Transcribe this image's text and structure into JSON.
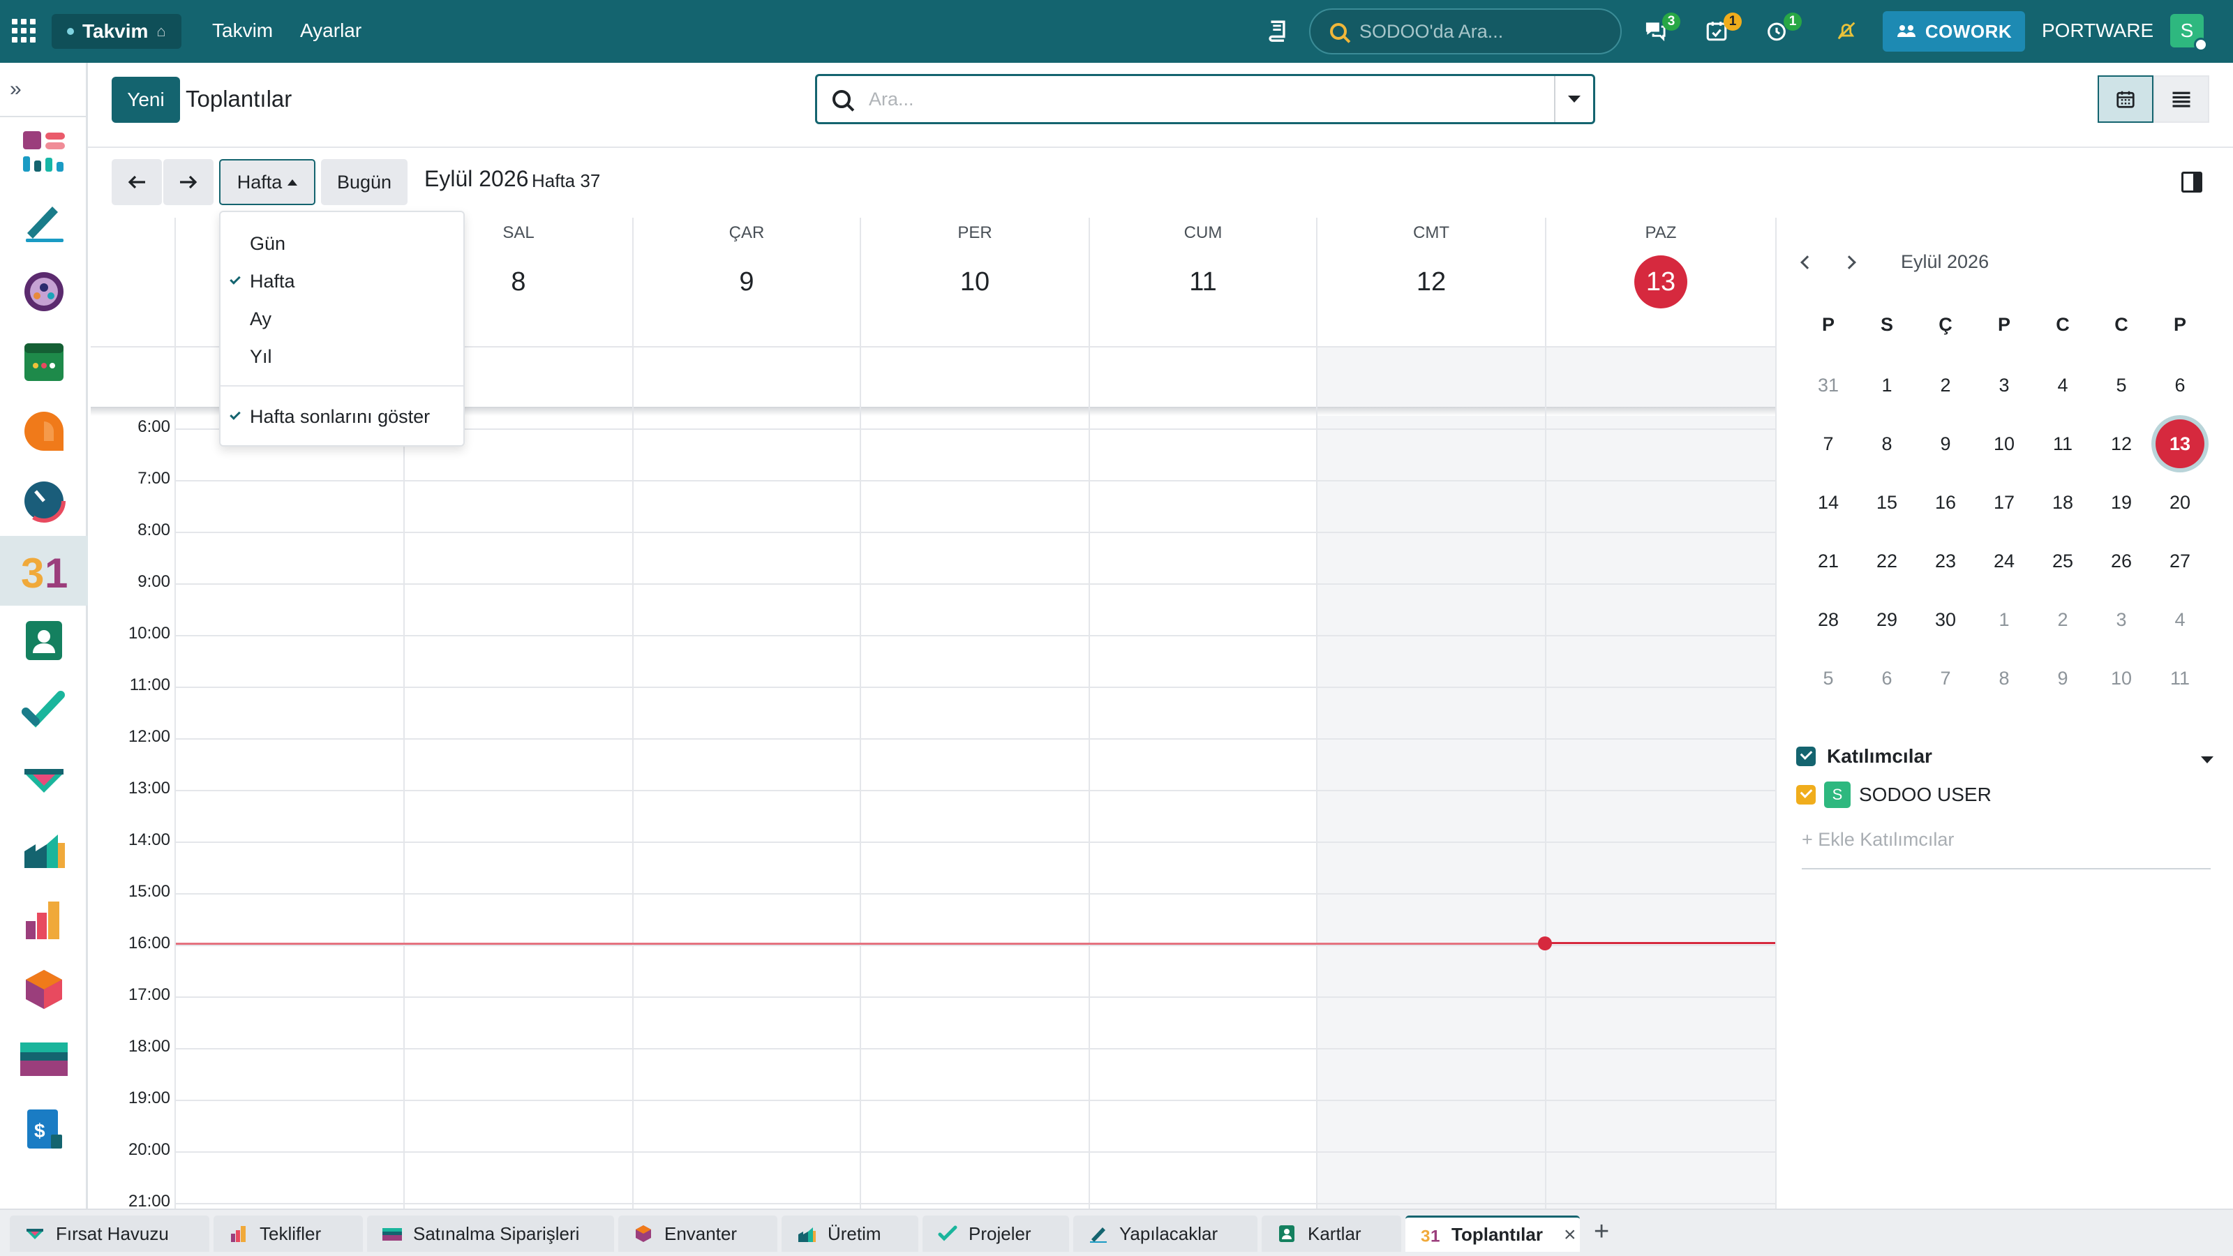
{
  "topbar": {
    "app_name": "Takvim",
    "menu": [
      "Takvim",
      "Ayarlar"
    ],
    "search_placeholder": "SODOO'da Ara...",
    "messages_count": "3",
    "activities_count": "1",
    "timer_count": "1",
    "cowork_label": "COWORK",
    "company": "PORTWARE",
    "user_initial": "S",
    "brand_color": "#14646f"
  },
  "sidebar": {
    "items": [
      "dashboard-app-icon",
      "sign-app-icon",
      "team-app-icon",
      "planning-app-icon",
      "discuss-app-icon",
      "timesheet-app-icon",
      "calendar-app-icon",
      "contacts-app-icon",
      "project-app-icon",
      "crm-app-icon",
      "manufacturing-app-icon",
      "sales-app-icon",
      "inventory-app-icon",
      "purchase-app-icon",
      "invoicing-app-icon"
    ]
  },
  "control_panel": {
    "new_label": "Yeni",
    "title": "Toplantılar",
    "search_placeholder": "Ara..."
  },
  "toolbar": {
    "scale_label": "Hafta",
    "today_label": "Bugün",
    "period": "Eylül 2026",
    "week_label": "Hafta 37"
  },
  "scale_menu": {
    "items": [
      "Gün",
      "Hafta",
      "Ay",
      "Yıl"
    ],
    "selected": "Hafta",
    "weekend_label": "Hafta sonlarını göster",
    "weekend_checked": true
  },
  "week": {
    "days": [
      {
        "name": "SAL",
        "date": "8"
      },
      {
        "name": "ÇAR",
        "date": "9"
      },
      {
        "name": "PER",
        "date": "10"
      },
      {
        "name": "CUM",
        "date": "11"
      },
      {
        "name": "CMT",
        "date": "12"
      },
      {
        "name": "PAZ",
        "date": "13"
      }
    ],
    "today": "13",
    "hours": [
      "6:00",
      "7:00",
      "8:00",
      "9:00",
      "10:00",
      "11:00",
      "12:00",
      "13:00",
      "14:00",
      "15:00",
      "16:00",
      "17:00",
      "18:00",
      "19:00",
      "20:00",
      "21:00"
    ],
    "current_time": "16:00",
    "today_color": "#d6293e"
  },
  "mini_calendar": {
    "title": "Eylül 2026",
    "dow": [
      "P",
      "S",
      "Ç",
      "P",
      "C",
      "C",
      "P"
    ],
    "weeks": [
      [
        "31",
        "1",
        "2",
        "3",
        "4",
        "5",
        "6"
      ],
      [
        "7",
        "8",
        "9",
        "10",
        "11",
        "12",
        "13"
      ],
      [
        "14",
        "15",
        "16",
        "17",
        "18",
        "19",
        "20"
      ],
      [
        "21",
        "22",
        "23",
        "24",
        "25",
        "26",
        "27"
      ],
      [
        "28",
        "29",
        "30",
        "1",
        "2",
        "3",
        "4"
      ],
      [
        "5",
        "6",
        "7",
        "8",
        "9",
        "10",
        "11"
      ]
    ],
    "today": "13"
  },
  "filters": {
    "title": "Katılımcılar",
    "attendee_initial": "S",
    "attendee_name": "SODOO USER",
    "add_placeholder": "+ Ekle Katılımcılar"
  },
  "tabs": [
    {
      "label": "Fırsat Havuzu"
    },
    {
      "label": "Teklifler"
    },
    {
      "label": "Satınalma Siparişleri"
    },
    {
      "label": "Envanter"
    },
    {
      "label": "Üretim"
    },
    {
      "label": "Projeler"
    },
    {
      "label": "Yapılacaklar"
    },
    {
      "label": "Kartlar"
    },
    {
      "label": "Toplantılar"
    }
  ],
  "active_tab": "Toplantılar"
}
